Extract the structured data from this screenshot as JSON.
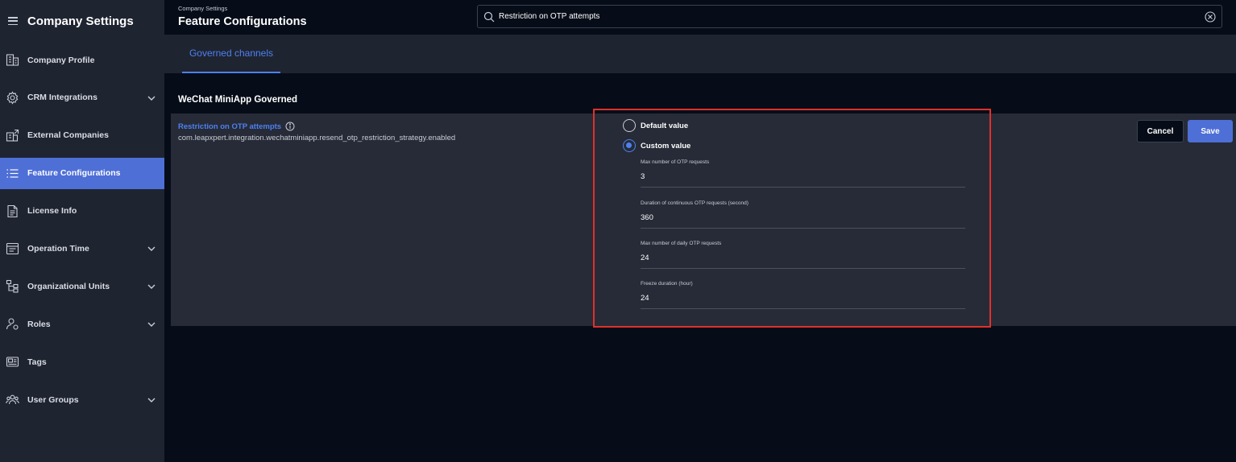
{
  "sidebar": {
    "title": "Company Settings",
    "items": [
      {
        "label": "Company Profile",
        "icon": "building-icon",
        "expandable": false
      },
      {
        "label": "CRM Integrations",
        "icon": "gear-icon",
        "expandable": true
      },
      {
        "label": "External Companies",
        "icon": "external-building-icon",
        "expandable": false
      },
      {
        "label": "Feature Configurations",
        "icon": "list-icon",
        "expandable": false,
        "active": true
      },
      {
        "label": "License Info",
        "icon": "document-icon",
        "expandable": false
      },
      {
        "label": "Operation Time",
        "icon": "calendar-icon",
        "expandable": true
      },
      {
        "label": "Organizational Units",
        "icon": "hierarchy-icon",
        "expandable": true
      },
      {
        "label": "Roles",
        "icon": "user-role-icon",
        "expandable": true
      },
      {
        "label": "Tags",
        "icon": "tag-icon",
        "expandable": false
      },
      {
        "label": "User Groups",
        "icon": "users-icon",
        "expandable": true
      }
    ]
  },
  "header": {
    "breadcrumb": "Company Settings",
    "title": "Feature Configurations"
  },
  "search": {
    "value": "Restriction on OTP attempts",
    "placeholder": "Search"
  },
  "tabs": [
    {
      "label": "Governed channels",
      "active": true
    }
  ],
  "section": {
    "title": "WeChat MiniApp Governed"
  },
  "config": {
    "name": "Restriction on OTP attempts",
    "key": "com.leapxpert.integration.wechatminiapp.resend_otp_restriction_strategy.enabled",
    "options": [
      {
        "label": "Default value",
        "checked": false
      },
      {
        "label": "Custom value",
        "checked": true
      }
    ],
    "fields": [
      {
        "label": "Max number of OTP requests",
        "value": "3"
      },
      {
        "label": "Duration of continuous OTP requests (second)",
        "value": "360"
      },
      {
        "label": "Max number of daily OTP requests",
        "value": "24"
      },
      {
        "label": "Freeze duration (hour)",
        "value": "24"
      }
    ]
  },
  "actions": {
    "cancel_label": "Cancel",
    "save_label": "Save"
  },
  "colors": {
    "accent": "#4e80f0",
    "primary_button": "#4e6fd6",
    "highlight": "#e1302a",
    "sidebar_bg": "#1f2431",
    "page_bg": "#060d18"
  }
}
